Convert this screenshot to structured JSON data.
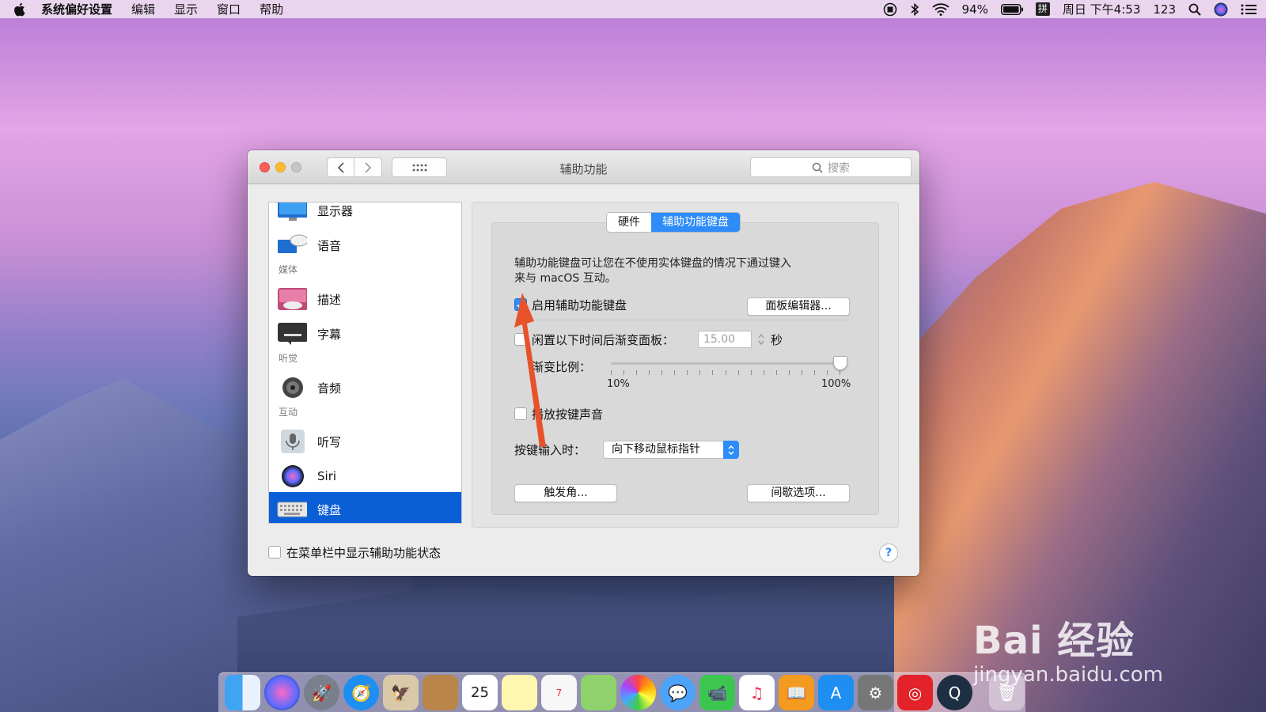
{
  "menubar": {
    "app_name": "系统偏好设置",
    "menus": [
      "编辑",
      "显示",
      "窗口",
      "帮助"
    ],
    "battery": "94%",
    "ime": "拼",
    "datetime": "周日 下午4:53",
    "input_label": "123"
  },
  "window": {
    "title": "辅助功能",
    "search_placeholder": "搜索"
  },
  "sidebar": {
    "items": [
      {
        "label": "显示器",
        "icon": "display-icon"
      },
      {
        "label": "语音",
        "icon": "speech-icon"
      },
      {
        "label": "描述",
        "icon": "descriptions-icon"
      },
      {
        "label": "字幕",
        "icon": "captions-icon"
      },
      {
        "label": "音频",
        "icon": "audio-icon"
      },
      {
        "label": "听写",
        "icon": "dictation-icon"
      },
      {
        "label": "Siri",
        "icon": "siri-icon"
      },
      {
        "label": "键盘",
        "icon": "keyboard-icon",
        "selected": true
      }
    ],
    "sections": [
      "媒体",
      "听觉",
      "互动"
    ]
  },
  "tabs": [
    {
      "label": "硬件",
      "active": false
    },
    {
      "label": "辅助功能键盘",
      "active": true
    }
  ],
  "panel": {
    "description_line1": "辅助功能键盘可让您在不使用实体键盘的情况下通过键入",
    "description_line2": "来与 macOS 互动。",
    "enable_label": "启用辅助功能键盘",
    "enable_checked": true,
    "panel_editor_button": "面板编辑器...",
    "fade_label": "闲置以下时间后渐变面板：",
    "fade_value": "15.00",
    "fade_unit": "秒",
    "fade_ratio_label": "渐变比例：",
    "slider_min": "10%",
    "slider_max": "100%",
    "slider_value": 1.0,
    "key_sound_label": "播放按键声音",
    "key_sound_checked": false,
    "on_keypress_label": "按键输入时：",
    "on_keypress_value": "向下移动鼠标指针",
    "hot_corners_button": "触发角...",
    "dwell_button": "间歇选项..."
  },
  "footer": {
    "menu_status_label": "在菜单栏中显示辅助功能状态",
    "menu_status_checked": false,
    "help_label": "?"
  },
  "dock": {
    "calendar_day": "25",
    "reminders_badge": "7"
  },
  "watermark": {
    "brand": "Bai 经验",
    "url": "jingyan.baidu.com"
  },
  "colors": {
    "accent": "#2d8cf7",
    "selection": "#0a5fd7",
    "annotation_arrow": "#e8522b"
  }
}
